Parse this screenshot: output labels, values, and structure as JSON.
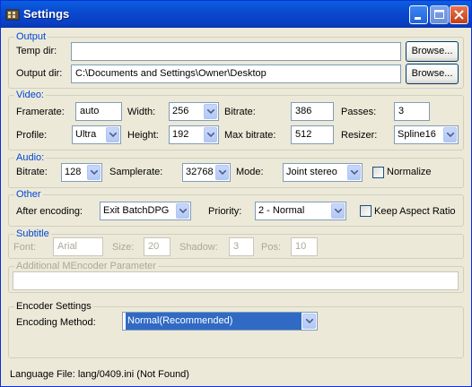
{
  "window": {
    "title": "Settings"
  },
  "output": {
    "legend": "Output",
    "temp_dir_label": "Temp dir:",
    "temp_dir_value": "",
    "output_dir_label": "Output dir:",
    "output_dir_value": "C:\\Documents and Settings\\Owner\\Desktop",
    "browse_label": "Browse..."
  },
  "video": {
    "legend": "Video:",
    "framerate_label": "Framerate:",
    "framerate_value": "auto",
    "width_label": "Width:",
    "width_value": "256",
    "bitrate_label": "Bitrate:",
    "bitrate_value": "386",
    "passes_label": "Passes:",
    "passes_value": "3",
    "profile_label": "Profile:",
    "profile_value": "Ultra",
    "height_label": "Height:",
    "height_value": "192",
    "maxbitrate_label": "Max bitrate:",
    "maxbitrate_value": "512",
    "resizer_label": "Resizer:",
    "resizer_value": "Spline16"
  },
  "audio": {
    "legend": "Audio:",
    "bitrate_label": "Bitrate:",
    "bitrate_value": "128",
    "samplerate_label": "Samplerate:",
    "samplerate_value": "32768",
    "mode_label": "Mode:",
    "mode_value": "Joint stereo",
    "normalize_label": "Normalize",
    "normalize_checked": false
  },
  "other": {
    "legend": "Other",
    "after_label": "After encoding:",
    "after_value": "Exit BatchDPG",
    "priority_label": "Priority:",
    "priority_value": "2 - Normal",
    "keep_aspect_label": "Keep Aspect Ratio",
    "keep_aspect_checked": false
  },
  "subtitle": {
    "legend": "Subtitle",
    "font_label": "Font:",
    "font_value": "Arial",
    "size_label": "Size:",
    "size_value": "20",
    "shadow_label": "Shadow:",
    "shadow_value": "3",
    "pos_label": "Pos:",
    "pos_value": "10"
  },
  "mencoder": {
    "legend": "Additional MEncoder Parameter",
    "value": ""
  },
  "encoder": {
    "legend": "Encoder Settings",
    "method_label": "Encoding Method:",
    "method_value": "Normal(Recommended)"
  },
  "status": {
    "language_file": "Language File: lang/0409.ini (Not Found)"
  },
  "colors": {
    "titlebar": "#0a4ad0",
    "legend_text": "#0046d5",
    "dialog_bg": "#ece9d8",
    "selection": "#316ac5"
  }
}
